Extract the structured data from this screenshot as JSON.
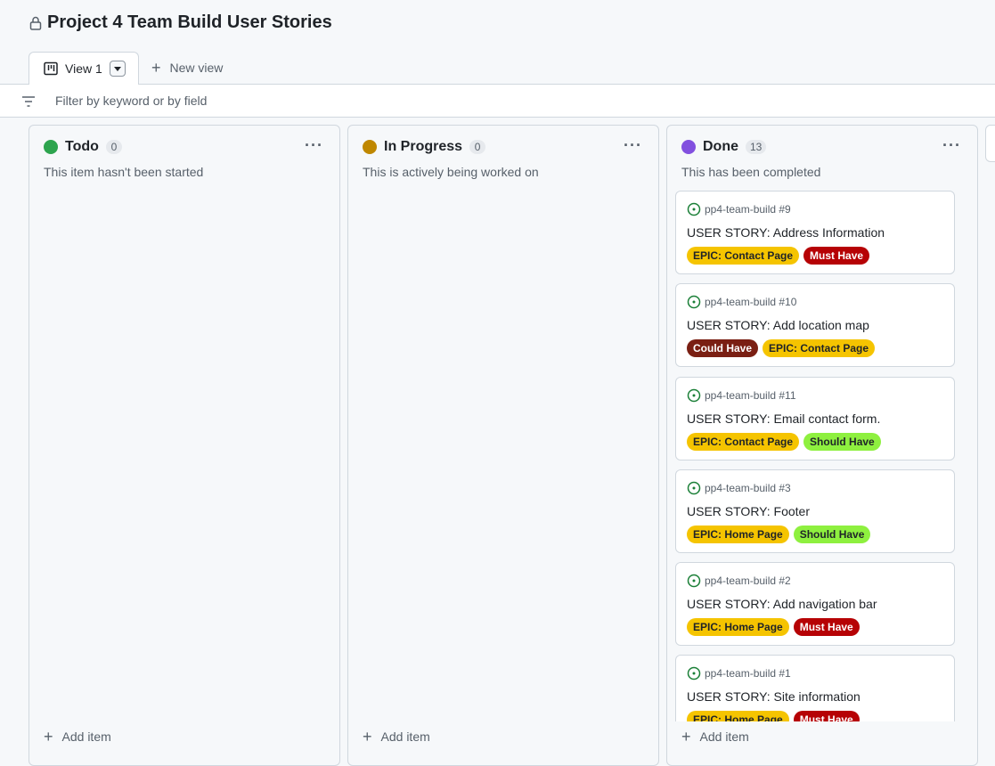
{
  "page": {
    "title": "Project 4 Team Build User Stories"
  },
  "tabs": {
    "view_label": "View 1",
    "new_view_label": "New view"
  },
  "filter": {
    "placeholder": "Filter by keyword or by field"
  },
  "columns": [
    {
      "name": "Todo",
      "count": "0",
      "description": "This item hasn't been started",
      "dot_color": "#2da44e",
      "add_label": "Add item"
    },
    {
      "name": "In Progress",
      "count": "0",
      "description": "This is actively being worked on",
      "dot_color": "#bf8700",
      "add_label": "Add item"
    },
    {
      "name": "Done",
      "count": "13",
      "description": "This has been completed",
      "dot_color": "#8250df",
      "add_label": "Add item",
      "cards": [
        {
          "ref": "pp4-team-build #9",
          "title": "USER STORY: Address Information",
          "labels": [
            {
              "text": "EPIC: Contact Page",
              "bg": "#f5c400",
              "fg": "#1f2328"
            },
            {
              "text": "Must Have",
              "bg": "#b60205",
              "fg": "#ffffff"
            }
          ]
        },
        {
          "ref": "pp4-team-build #10",
          "title": "USER STORY: Add location map",
          "labels": [
            {
              "text": "Could Have",
              "bg": "#7a1f13",
              "fg": "#ffffff"
            },
            {
              "text": "EPIC: Contact Page",
              "bg": "#f5c400",
              "fg": "#1f2328"
            }
          ]
        },
        {
          "ref": "pp4-team-build #11",
          "title": "USER STORY: Email contact form.",
          "labels": [
            {
              "text": "EPIC: Contact Page",
              "bg": "#f5c400",
              "fg": "#1f2328"
            },
            {
              "text": "Should Have",
              "bg": "#8ef03f",
              "fg": "#1f2328"
            }
          ]
        },
        {
          "ref": "pp4-team-build #3",
          "title": "USER STORY: Footer",
          "labels": [
            {
              "text": "EPIC: Home Page",
              "bg": "#f5c400",
              "fg": "#1f2328"
            },
            {
              "text": "Should Have",
              "bg": "#8ef03f",
              "fg": "#1f2328"
            }
          ]
        },
        {
          "ref": "pp4-team-build #2",
          "title": "USER STORY: Add navigation bar",
          "labels": [
            {
              "text": "EPIC: Home Page",
              "bg": "#f5c400",
              "fg": "#1f2328"
            },
            {
              "text": "Must Have",
              "bg": "#b60205",
              "fg": "#ffffff"
            }
          ]
        },
        {
          "ref": "pp4-team-build #1",
          "title": "USER STORY: Site information",
          "labels": [
            {
              "text": "EPIC: Home Page",
              "bg": "#f5c400",
              "fg": "#1f2328"
            },
            {
              "text": "Must Have",
              "bg": "#b60205",
              "fg": "#ffffff"
            }
          ]
        }
      ]
    }
  ],
  "icons": {
    "lock": "lock-icon",
    "board": "project-board-icon",
    "filter": "filter-icon",
    "issue": "issue-open-icon",
    "more": "kebab-horizontal-icon",
    "plus": "plus-icon"
  }
}
